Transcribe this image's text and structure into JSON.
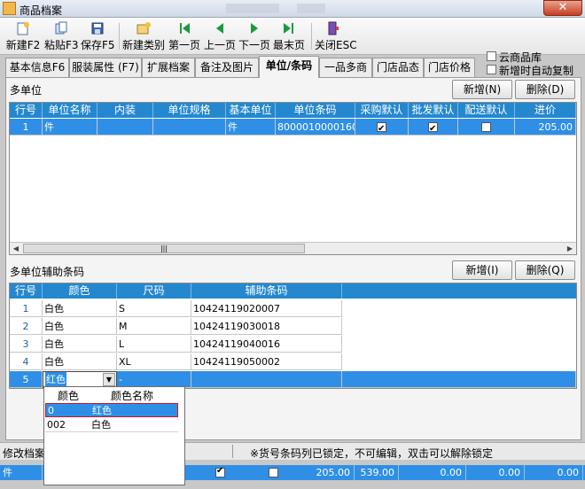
{
  "window": {
    "title": "商品档案",
    "close_glyph": "✕"
  },
  "toolbar": {
    "new": "新建F2",
    "paste": "粘贴F3",
    "save": "保存F5",
    "new_category": "新建类别",
    "first": "第一页",
    "prev": "上一页",
    "next": "下一页",
    "last": "最末页",
    "close": "关闭ESC"
  },
  "tabs": [
    "基本信息F6",
    "服装属性 (F7)",
    "扩展档案",
    "备注及图片",
    "单位/条码",
    "一品多商",
    "门店品态",
    "门店价格"
  ],
  "options": {
    "cloud_library": "云商品库",
    "auto_copy": "新增时自动复制"
  },
  "multi_unit": {
    "section_label": "多单位",
    "add_button": "新增(N)",
    "delete_button": "删除(D)",
    "columns": [
      "行号",
      "单位名称",
      "内装",
      "单位规格",
      "基本单位",
      "单位条码",
      "采购默认",
      "批发默认",
      "配送默认",
      "进价"
    ],
    "rows": [
      {
        "no": "1",
        "unit_name": "件",
        "inner": "",
        "spec": "",
        "base_unit": "件",
        "barcode": "8000010000160",
        "purchase_default": true,
        "wholesale_default": true,
        "delivery_default": false,
        "cost": "205.00"
      }
    ]
  },
  "aux_barcode": {
    "section_label": "多单位辅助条码",
    "add_button": "新增(I)",
    "delete_button": "删除(Q)",
    "columns": [
      "行号",
      "颜色",
      "尺码",
      "辅助条码"
    ],
    "rows": [
      {
        "no": "1",
        "color": "白色",
        "size": "S",
        "barcode": "10424119020007"
      },
      {
        "no": "2",
        "color": "白色",
        "size": "M",
        "barcode": "10424119030018"
      },
      {
        "no": "3",
        "color": "白色",
        "size": "L",
        "barcode": "10424119040016"
      },
      {
        "no": "4",
        "color": "白色",
        "size": "XL",
        "barcode": "10424119050002"
      },
      {
        "no": "5",
        "color": "红色",
        "size": "",
        "barcode": ""
      }
    ],
    "editing_size_placeholder": "-"
  },
  "color_dropdown": {
    "columns": [
      "颜色",
      "颜色名称"
    ],
    "options": [
      {
        "code": "0",
        "name": "红色"
      },
      {
        "code": "002",
        "name": "白色"
      }
    ]
  },
  "status": {
    "left": "修改档案",
    "message": "※货号条码列已锁定，不可编辑，双击可以解除锁定"
  },
  "background_row": {
    "unit": "件",
    "checked": true,
    "unchecked": false,
    "values": [
      "205.00",
      "539.00",
      "0.00",
      "0.00",
      "0.00"
    ]
  },
  "colors": {
    "header_blue": "#2588cf",
    "selection_blue": "#2f8fe6",
    "dropdown_highlight_border": "#c0192b"
  }
}
